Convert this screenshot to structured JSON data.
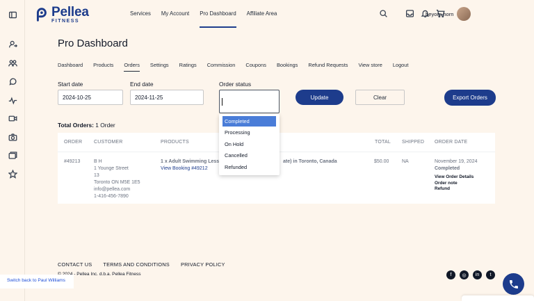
{
  "brand": {
    "name": "Pellea",
    "sub": "FITNESS"
  },
  "topnav": [
    {
      "label": "Services"
    },
    {
      "label": "My Account"
    },
    {
      "label": "Pro Dashboard",
      "active": true
    },
    {
      "label": "Affiliate Area"
    }
  ],
  "user": {
    "name": "beyorn horn"
  },
  "page": {
    "title": "Pro Dashboard"
  },
  "subnav": [
    "Dashboard",
    "Products",
    "Orders",
    "Settings",
    "Ratings",
    "Commission",
    "Coupons",
    "Bookings",
    "Refund Requests",
    "View store",
    "Logout"
  ],
  "subnav_active": "Orders",
  "filters": {
    "start_label": "Start date",
    "start_value": "2024-10-25",
    "end_label": "End date",
    "end_value": "2024-11-25",
    "status_label": "Order status",
    "update": "Update",
    "clear": "Clear",
    "export": "Export Orders"
  },
  "total": {
    "label": "Total Orders:",
    "value": " 1 Order"
  },
  "table": {
    "headers": [
      "ORDER",
      "CUSTOMER",
      "PRODUCTS",
      "TOTAL",
      "SHIPPED",
      "ORDER DATE"
    ],
    "row": {
      "order": "#49213",
      "customer": [
        "B H",
        "1 Younge Street",
        "13",
        "Toronto ON M5E 1E5",
        "info@pellea.com",
        "1-416-456-7890"
      ],
      "product": "1 x Adult Swimming Lesso",
      "product_tail": "ate) in Toronto, Canada",
      "booking": "View Booking #49212",
      "total": "$50.00",
      "shipped": "NA",
      "date": "November 19, 2024",
      "status": "Completed",
      "actions": [
        "View Order Details",
        "Order note",
        "Refund"
      ]
    }
  },
  "dropdown": {
    "options": [
      "Completed",
      "Processing",
      "On Hold",
      "Cancelled",
      "Refunded"
    ],
    "selected": "Completed"
  },
  "footer": {
    "links": [
      "CONTACT US",
      "TERMS AND CONDITIONS",
      "PRIVACY POLICY"
    ],
    "copyright": "© 2024 - Pellea Inc. d.b.a. Pellea Fitness",
    "socials": [
      "facebook-icon",
      "instagram-icon",
      "linkedin-icon",
      "twitter-icon"
    ]
  },
  "switch_user": "Switch back to Paul Williams",
  "colors": {
    "brand": "#1d3c8c",
    "background": "#fdf5ec",
    "highlight": "#4a7dd8"
  }
}
